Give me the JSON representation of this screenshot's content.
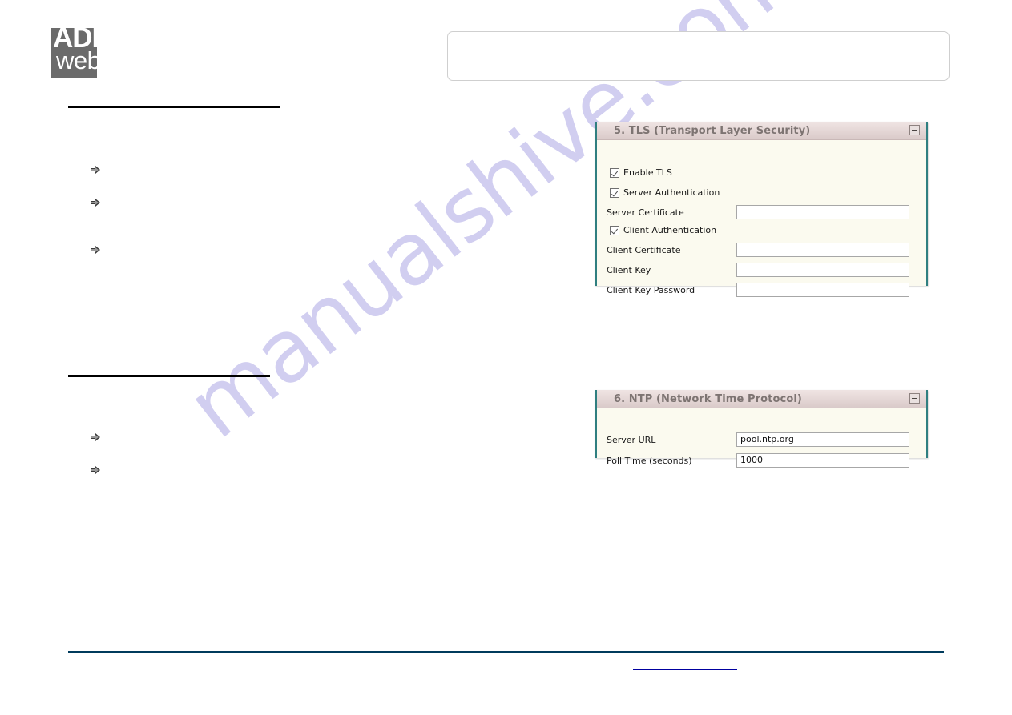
{
  "page": {
    "background_color": "#ffffff",
    "watermark": "manualshive.com",
    "watermark_color": "#c9c6ee"
  },
  "header": {
    "logo": {
      "line1": "ADF",
      "line2": "web",
      "background_color": "#6b6b6b",
      "text_color": "#ffffff"
    },
    "title_box": {
      "text": "",
      "border_color": "#cfcfcf"
    }
  },
  "document": {
    "sections": [
      {
        "heading": "",
        "rule": true,
        "bullets": [
          "",
          "",
          ""
        ]
      },
      {
        "heading": "",
        "rule": true,
        "bullets": [
          "",
          ""
        ]
      }
    ]
  },
  "panels": [
    {
      "id": "tls",
      "title": "5. TLS (Transport Layer Security)",
      "collapse_icon": "minimize-icon",
      "accent_color": "#2f7f80",
      "header_color": "#e4d6d5",
      "body_color": "#fbfaef",
      "checkboxes": [
        {
          "label": "Enable TLS",
          "checked": true
        },
        {
          "label": "Server Authentication",
          "checked": true
        },
        {
          "label": "Client Authentication",
          "checked": true
        }
      ],
      "fields": [
        {
          "label": "Server Certificate",
          "value": ""
        },
        {
          "label": "Client Certificate",
          "value": ""
        },
        {
          "label": "Client Key",
          "value": ""
        },
        {
          "label": "Client Key Password",
          "value": ""
        }
      ]
    },
    {
      "id": "ntp",
      "title": "6. NTP (Network Time Protocol)",
      "collapse_icon": "minimize-icon",
      "accent_color": "#2f7f80",
      "header_color": "#e4d6d5",
      "body_color": "#fbfaef",
      "checkboxes": [],
      "fields": [
        {
          "label": "Server URL",
          "value": "pool.ntp.org"
        },
        {
          "label": "Poll Time (seconds)",
          "value": "1000"
        }
      ]
    }
  ],
  "footer": {
    "rule_color": "#003b5c",
    "left_text": "",
    "link_text": "",
    "link_color": "#0000a0",
    "right_text": ""
  }
}
